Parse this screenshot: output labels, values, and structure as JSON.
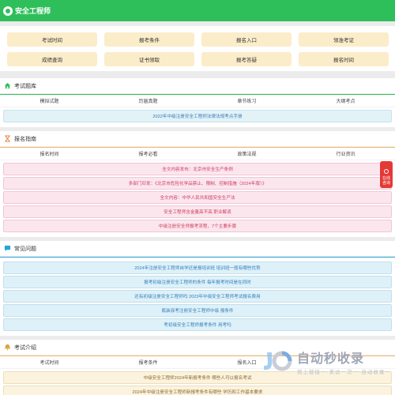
{
  "header": {
    "title": "安全工程师"
  },
  "quick_links": [
    "考试时间",
    "报考条件",
    "报名入口",
    "领准考证",
    "成绩查询",
    "证书领取",
    "报考答疑",
    "报名时间"
  ],
  "sections": {
    "exam_bank": {
      "title": "考试题库",
      "tabs": [
        "模拟试题",
        "历届真题",
        "章节练习",
        "大纲考点"
      ],
      "items": [
        "2022年中级注册安全工程师法律法规考点手册"
      ]
    },
    "guide": {
      "title": "报名指南",
      "tabs": [
        "报名时间",
        "报考必看",
        "政策法规",
        "行业资讯"
      ],
      "items": [
        "全文内容发布：北京市安全生产条例",
        "多部门印发：《北京市危险化学品禁止、限制、控制措施（2024年版）》",
        "全文内容：中华人民共和国安全生产法",
        "安全工程师含金量高不高 职业解读",
        "中级注册安全师报考流程，7个主要步骤"
      ]
    },
    "faq": {
      "title": "常见问题",
      "items": [
        "2024年注册安全工程师自学还是报培训班 培训班一般有哪些优势",
        "报考初级注册安全工程师的条件 每年报考时间是在同时",
        "还有初级注册安全工程师吗 2023年中级安全工程师考试报名费用",
        "瓶装液考注册安全工程师中级 报条件",
        "考初级安全工程师报考条件 用考吗"
      ]
    },
    "exam_intro": {
      "title": "考试介绍",
      "tabs": [
        "考试时间",
        "报考条件",
        "报名入口",
        ""
      ],
      "items": [
        "中级安全工程师2024年新报考条件 哪些人可以报名考试",
        "2024年中级注册安全工程师新报考条件有哪些 学历和工作基本要求"
      ]
    }
  },
  "float_consult": {
    "label": "在线咨询"
  },
  "watermark": {
    "main": "自动秒收录",
    "sub": "敛上链接一·来访一次一·自动收录一"
  },
  "colors": {
    "header_green": "#2fbf5a",
    "quick_btn": "#fbedc9",
    "pink": "#d03b5d",
    "blue": "#3a79b8"
  }
}
